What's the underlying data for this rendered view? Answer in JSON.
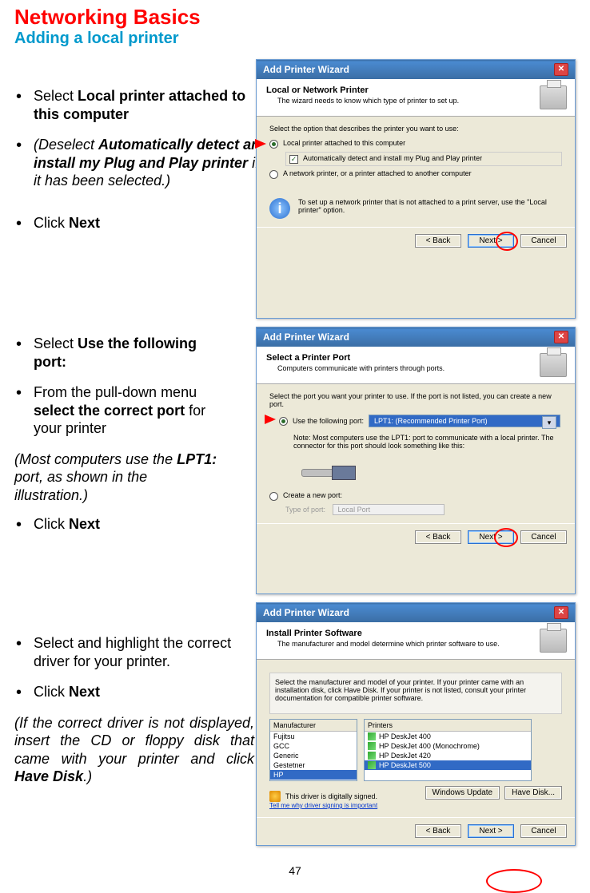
{
  "title": "Networking Basics",
  "subtitle": "Adding a local printer",
  "pagenum": "47",
  "section1": {
    "b1a": "Select ",
    "b1b": "Local printer attached to this computer",
    "b2a": "(Deselect ",
    "b2b": "Automatically detect and install my Plug and Play printer",
    "b2c": " if it has been selected.)",
    "b3a": "Click ",
    "b3b": "Next"
  },
  "section2": {
    "b1a": "Select ",
    "b1b": "Use the following port:",
    "b2a": "From the pull-down menu ",
    "b2b": "select the correct port",
    "b2c": " for your printer",
    "note1a": "(Most computers use the ",
    "note1b": "LPT1:",
    "note1c": " port, as shown in the illustration.)",
    "b3a": "Click ",
    "b3b": "Next"
  },
  "section3": {
    "b1": "Select and highlight the correct driver for your printer.",
    "b2a": "Click ",
    "b2b": "Next",
    "note1a": "(If the correct driver is not displayed, insert the CD or floppy disk that came with your printer and click ",
    "note1b": "Have Disk",
    "note1c": ".)"
  },
  "wiz1": {
    "title": "Add Printer Wizard",
    "hdr": "Local or Network Printer",
    "sub": "The wizard needs to know which type of printer to set up.",
    "prompt": "Select the option that describes the printer you want to use:",
    "opt1": "Local printer attached to this computer",
    "chk1": "Automatically detect and install my Plug and Play printer",
    "opt2": "A network printer, or a printer attached to another computer",
    "info": "To set up a network printer that is not attached to a print server, use the \"Local printer\" option.",
    "back": "< Back",
    "next": "Next >",
    "cancel": "Cancel"
  },
  "wiz2": {
    "title": "Add Printer Wizard",
    "hdr": "Select a Printer Port",
    "sub": "Computers communicate with printers through ports.",
    "prompt": "Select the port you want your printer to use. If the port is not listed, you can create a new port.",
    "opt1": "Use the following port:",
    "dd": "LPT1: (Recommended Printer Port)",
    "note": "Note: Most computers use the LPT1: port to communicate with a local printer. The connector for this port should look something like this:",
    "opt2": "Create a new port:",
    "typelbl": "Type of port:",
    "typeval": "Local Port",
    "back": "< Back",
    "next": "Next >",
    "cancel": "Cancel"
  },
  "wiz3": {
    "title": "Add Printer Wizard",
    "hdr": "Install Printer Software",
    "sub": "The manufacturer and model determine which printer software to use.",
    "prompt": "Select the manufacturer and model of your printer. If your printer came with an installation disk, click Have Disk. If your printer is not listed, consult your printer documentation for compatible printer software.",
    "mfgHdr": "Manufacturer",
    "prnHdr": "Printers",
    "mfg": [
      "Fujitsu",
      "GCC",
      "Generic",
      "Gestetner",
      "HP"
    ],
    "prn": [
      "HP DeskJet 400",
      "HP DeskJet 400 (Monochrome)",
      "HP DeskJet 420",
      "HP DeskJet 500"
    ],
    "signed": "This driver is digitally signed.",
    "tell": "Tell me why driver signing is important",
    "winupd": "Windows Update",
    "havedisk": "Have Disk...",
    "back": "< Back",
    "next": "Next >",
    "cancel": "Cancel"
  }
}
